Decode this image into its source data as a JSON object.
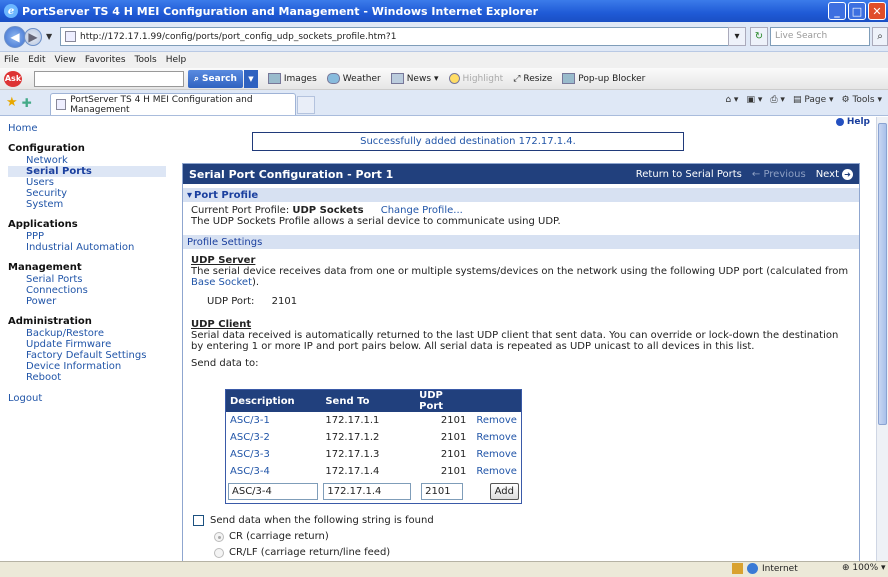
{
  "browser": {
    "window_title": "PortServer TS 4 H MEI Configuration and Management - Windows Internet Explorer",
    "address": "http://172.17.1.99/config/ports/port_config_udp_sockets_profile.htm?1",
    "search_placeholder": "Live Search",
    "menu": [
      "File",
      "Edit",
      "View",
      "Favorites",
      "Tools",
      "Help"
    ],
    "toolbar": {
      "search_label": "Search",
      "items": [
        "Images",
        "Weather",
        "News",
        "Highlight",
        "Resize",
        "Pop-up Blocker"
      ]
    },
    "tab_title": "PortServer TS 4 H MEI Configuration and Management",
    "tab_tools": [
      "Page",
      "Tools"
    ],
    "status": {
      "zone": "Internet",
      "zoom": "100%"
    }
  },
  "help_label": "Help",
  "nav": {
    "home": "Home",
    "configuration": {
      "title": "Configuration",
      "items": [
        "Network",
        "Serial Ports",
        "Users",
        "Security",
        "System"
      ]
    },
    "applications": {
      "title": "Applications",
      "items": [
        "PPP",
        "Industrial Automation"
      ]
    },
    "management": {
      "title": "Management",
      "items": [
        "Serial Ports",
        "Connections",
        "Power"
      ]
    },
    "administration": {
      "title": "Administration",
      "items": [
        "Backup/Restore",
        "Update Firmware",
        "Factory Default Settings",
        "Device Information",
        "Reboot"
      ]
    },
    "logout": "Logout"
  },
  "message": "Successfully added destination 172.17.1.4.",
  "panel": {
    "title": "Serial Port Configuration - Port 1",
    "return_link": "Return to Serial Ports",
    "previous": "Previous",
    "next": "Next",
    "port_profile_header": "Port Profile",
    "current_profile_label": "Current Port Profile:",
    "current_profile_value": "UDP Sockets",
    "change_profile": "Change Profile...",
    "profile_desc": "The UDP Sockets Profile allows a serial device to communicate using UDP.",
    "settings_header": "Profile Settings",
    "udp_server_title": "UDP Server",
    "udp_server_desc": "The serial device receives data from one or multiple systems/devices on the network using the following UDP port (calculated from",
    "udp_server_link": "Base Socket",
    "udp_server_desc_end": ").",
    "udp_port_label": "UDP Port:",
    "udp_port_value": "2101",
    "udp_client_title": "UDP Client",
    "udp_client_desc": "Serial data received is automatically returned to the last UDP client that sent data. You can override or lock-down the destination by entering 1 or more IP and port pairs below. All serial data is repeated as UDP unicast to all devices in this list.",
    "send_data_label": "Send data to:",
    "table": {
      "headers": [
        "Description",
        "Send To",
        "UDP Port",
        ""
      ],
      "rows": [
        {
          "desc": "ASC/3-1",
          "ip": "172.17.1.1",
          "port": "2101",
          "action": "Remove"
        },
        {
          "desc": "ASC/3-2",
          "ip": "172.17.1.2",
          "port": "2101",
          "action": "Remove"
        },
        {
          "desc": "ASC/3-3",
          "ip": "172.17.1.3",
          "port": "2101",
          "action": "Remove"
        },
        {
          "desc": "ASC/3-4",
          "ip": "172.17.1.4",
          "port": "2101",
          "action": "Remove"
        }
      ],
      "input_desc": "ASC/3-4",
      "input_ip": "172.17.1.4",
      "input_port": "2101",
      "add_label": "Add"
    },
    "send_string_label": "Send data when the following string is found",
    "radio_cr": "CR (carriage return)",
    "radio_crlf": "CR/LF (carriage return/line feed)"
  }
}
